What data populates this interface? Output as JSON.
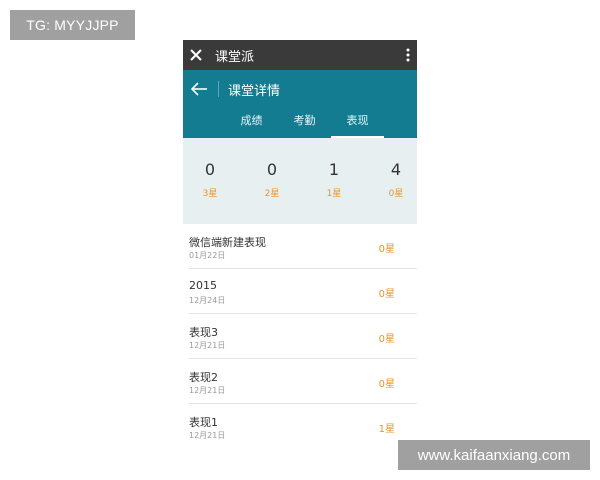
{
  "watermarks": {
    "top": "TG: MYYJJPP",
    "bottom": "www.kaifaanxiang.com"
  },
  "app": {
    "title": "课堂派"
  },
  "header": {
    "title": "课堂详情"
  },
  "tabs": [
    {
      "label": "成绩"
    },
    {
      "label": "考勤"
    },
    {
      "label": "表现",
      "active": true
    }
  ],
  "stats": [
    {
      "count": "0",
      "label": "3星"
    },
    {
      "count": "0",
      "label": "2星"
    },
    {
      "count": "1",
      "label": "1星"
    },
    {
      "count": "4",
      "label": "0星"
    }
  ],
  "records": [
    {
      "title": "微信端新建表现",
      "date": "01月22日",
      "stars": "0星"
    },
    {
      "title": "2015",
      "date": "12月24日",
      "stars": "0星"
    },
    {
      "title": "表现3",
      "date": "12月21日",
      "stars": "0星"
    },
    {
      "title": "表现2",
      "date": "12月21日",
      "stars": "0星"
    },
    {
      "title": "表现1",
      "date": "12月21日",
      "stars": "1星"
    }
  ],
  "colors": {
    "teal": "#137c90",
    "topbar": "#3a3a3a",
    "accent": "#e3962a",
    "stats_bg": "#e8eff1"
  },
  "icons": [
    "close-icon",
    "more-icon",
    "back-arrow-icon"
  ]
}
